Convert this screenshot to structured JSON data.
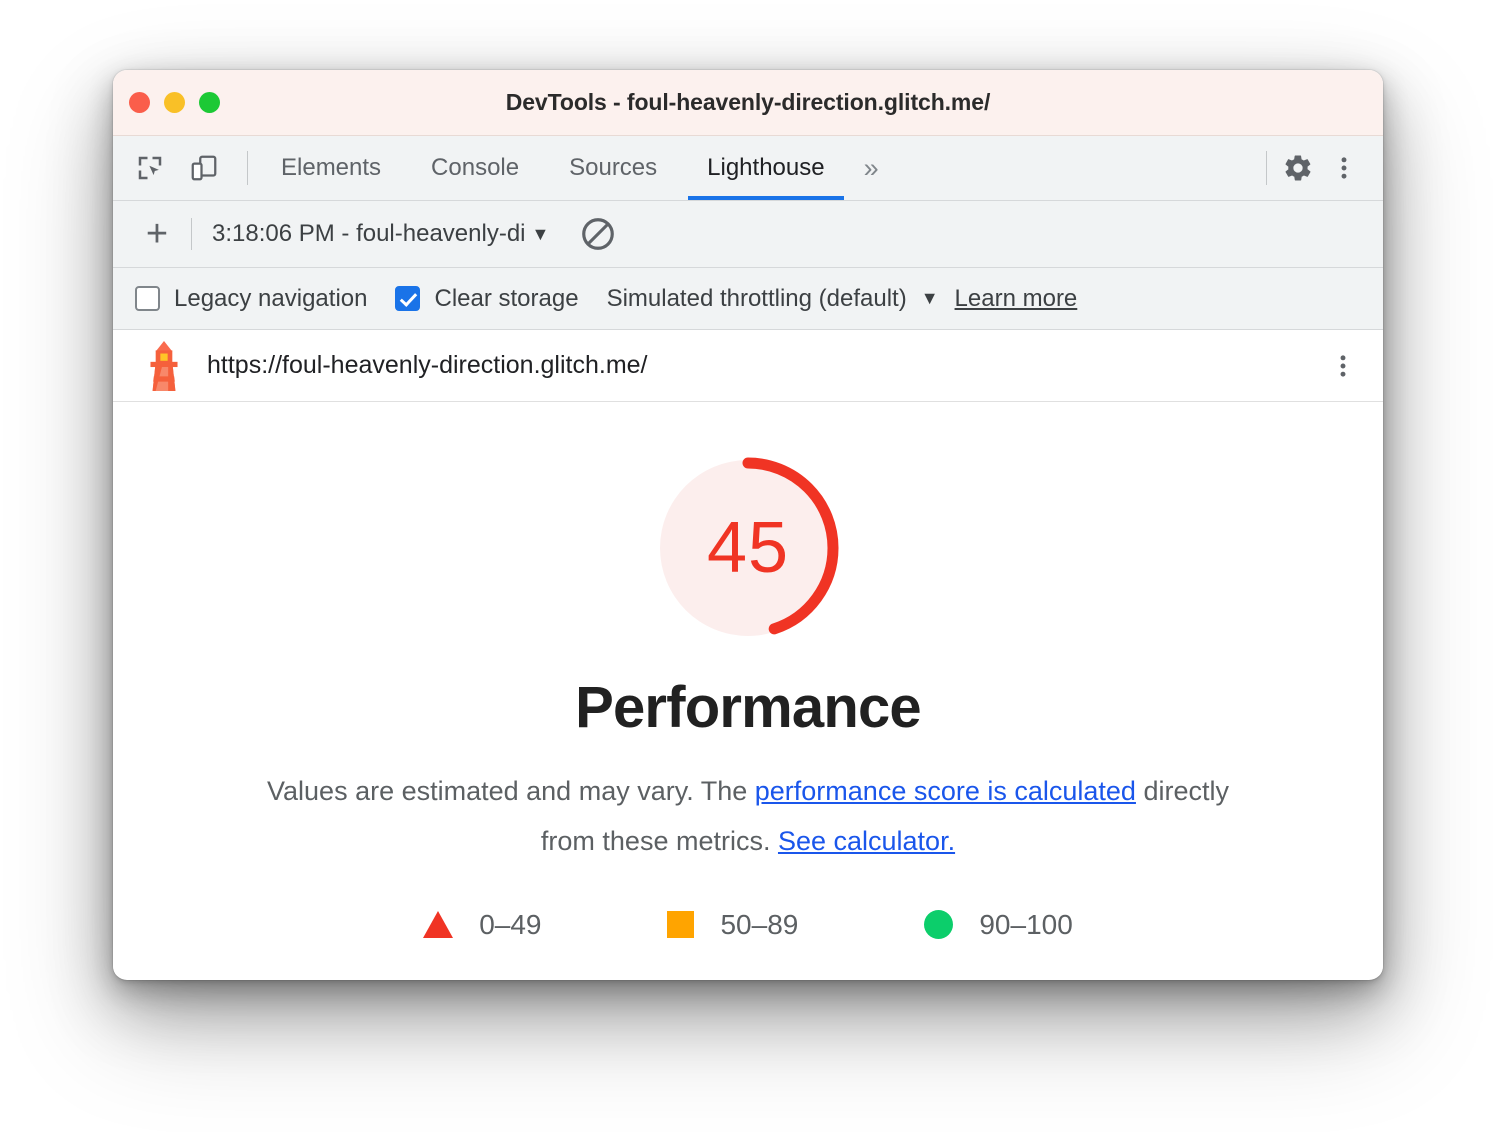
{
  "window": {
    "title": "DevTools - foul-heavenly-direction.glitch.me/",
    "traffic_lights": [
      "close",
      "minimize",
      "maximize"
    ]
  },
  "tabstrip": {
    "left_icons": [
      {
        "name": "inspect-element-icon",
        "label": "Inspect element"
      },
      {
        "name": "device-toolbar-icon",
        "label": "Toggle device toolbar"
      }
    ],
    "tabs": [
      {
        "label": "Elements",
        "active": false
      },
      {
        "label": "Console",
        "active": false
      },
      {
        "label": "Sources",
        "active": false
      },
      {
        "label": "Lighthouse",
        "active": true
      }
    ],
    "more_tabs": "»",
    "right_icons": [
      {
        "name": "settings-gear-icon",
        "label": "Settings"
      },
      {
        "name": "more-options-kebab-icon",
        "label": "Customize and control DevTools"
      }
    ]
  },
  "runbar": {
    "new_report_label": "+",
    "report_selector_value": "3:18:06 PM - foul-heavenly-di",
    "caret": "▼",
    "clear_all_label": "Clear all"
  },
  "options": {
    "legacy_navigation": {
      "label": "Legacy navigation",
      "checked": false
    },
    "clear_storage": {
      "label": "Clear storage",
      "checked": true
    },
    "throttling": {
      "label": "Simulated throttling (default)",
      "caret": "▼"
    },
    "learn_more": "Learn more"
  },
  "url_row": {
    "icon": "lighthouse-icon",
    "url": "https://foul-heavenly-direction.glitch.me/",
    "menu": "more-options-kebab-icon"
  },
  "report": {
    "score": "45",
    "category": "Performance",
    "disclaimer_prefix": "Values are estimated and may vary. The ",
    "link_score_calculated": "performance score is calculated",
    "disclaimer_middle": " directly from these metrics. ",
    "link_see_calculator": "See calculator.",
    "legend": [
      {
        "mark": "triangle",
        "range": "0–49",
        "color": "#f03424"
      },
      {
        "mark": "square",
        "range": "50–89",
        "color": "#ffa400"
      },
      {
        "mark": "circle",
        "range": "90–100",
        "color": "#0cce6b"
      }
    ]
  },
  "chart_data": {
    "type": "gauge",
    "title": "Performance",
    "value": 45,
    "range": [
      0,
      100
    ],
    "arc_fraction": 0.45,
    "arc_color": "#f03424",
    "track_color": "#fceeed",
    "bands": [
      {
        "label": "0–49",
        "min": 0,
        "max": 49,
        "color": "#f03424",
        "marker": "triangle"
      },
      {
        "label": "50–89",
        "min": 50,
        "max": 89,
        "color": "#ffa400",
        "marker": "square"
      },
      {
        "label": "90–100",
        "min": 90,
        "max": 100,
        "color": "#0cce6b",
        "marker": "circle"
      }
    ]
  },
  "colors": {
    "accent_blue": "#1a73e8",
    "titlebar_bg": "#fcf1ee",
    "toolbar_bg": "#f1f3f4",
    "score_red": "#f03424",
    "link_blue": "#1a56eb"
  }
}
